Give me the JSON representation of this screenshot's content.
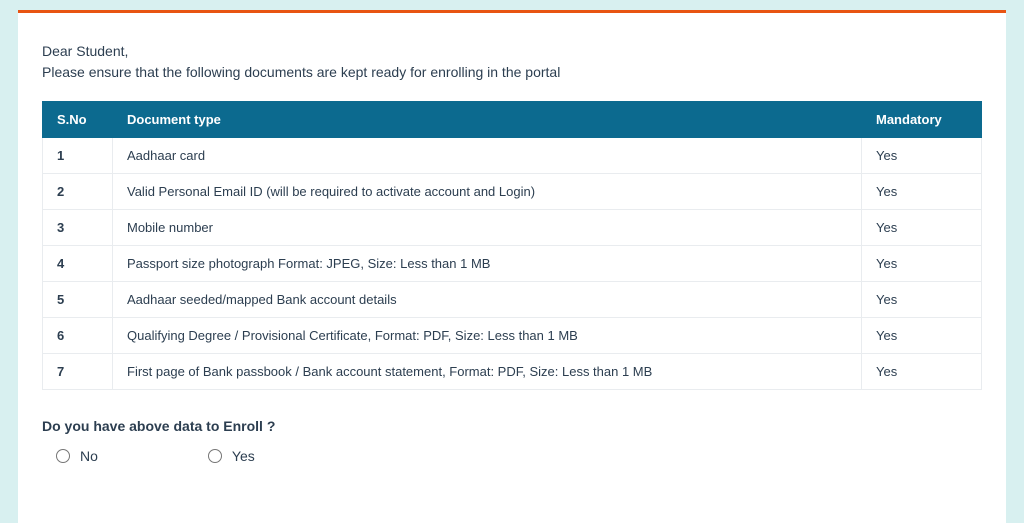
{
  "intro": {
    "salutation": "Dear Student,",
    "line": "Please ensure that the following documents are kept ready for enrolling in the portal"
  },
  "table": {
    "headers": {
      "sno": "S.No",
      "doctype": "Document type",
      "mandatory": "Mandatory"
    },
    "rows": [
      {
        "sno": "1",
        "doctype": "Aadhaar card",
        "mandatory": "Yes"
      },
      {
        "sno": "2",
        "doctype": "Valid Personal Email ID (will be required to activate account and Login)",
        "mandatory": "Yes"
      },
      {
        "sno": "3",
        "doctype": "Mobile number",
        "mandatory": "Yes"
      },
      {
        "sno": "4",
        "doctype": "Passport size photograph Format: JPEG, Size: Less than 1 MB",
        "mandatory": "Yes"
      },
      {
        "sno": "5",
        "doctype": "Aadhaar seeded/mapped Bank account details",
        "mandatory": "Yes"
      },
      {
        "sno": "6",
        "doctype": "Qualifying Degree / Provisional Certificate, Format: PDF, Size: Less than 1 MB",
        "mandatory": "Yes"
      },
      {
        "sno": "7",
        "doctype": "First page of Bank passbook / Bank account statement, Format: PDF, Size: Less than 1 MB",
        "mandatory": "Yes"
      }
    ]
  },
  "question": "Do you have above data to Enroll ?",
  "options": {
    "no": "No",
    "yes": "Yes"
  }
}
